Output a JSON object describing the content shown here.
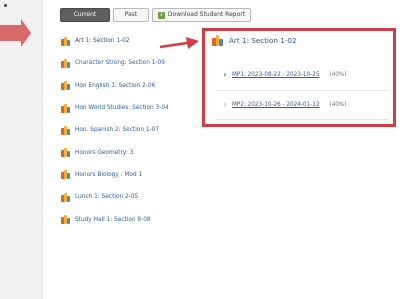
{
  "toolbar": {
    "current_label": "Current",
    "past_label": "Past",
    "report_label": "Download Student Report"
  },
  "courses": [
    {
      "label": "Art 1: Section 1-02"
    },
    {
      "label": "Character Strong: Section 1-09"
    },
    {
      "label": "Hon English 1: Section 2-06"
    },
    {
      "label": "Hon World Studies: Section 3-04"
    },
    {
      "label": "Hon. Spanish 2: Section 1-07"
    },
    {
      "label": "Honors Geometry: 3"
    },
    {
      "label": "Honors Biology : Mod 1"
    },
    {
      "label": "Lunch 1: Section 2-05"
    },
    {
      "label": "Study Hall 1: Section 8-08"
    }
  ],
  "detail": {
    "title": "Art 1: Section 1-02",
    "periods": [
      {
        "label": "MP1: 2023-08-22 - 2023-10-25",
        "percent": "(40%)"
      },
      {
        "label": "MP2: 2023-10-26 - 2024-01-12",
        "percent": "(40%)"
      }
    ]
  },
  "colors": {
    "highlight": "#d43b45",
    "link": "#2d5ea6",
    "active_tab": "#5e5e5e"
  },
  "icons": {
    "course": "course-folder-icon",
    "expand": "chevron-right-icon",
    "report": "download-report-icon"
  }
}
